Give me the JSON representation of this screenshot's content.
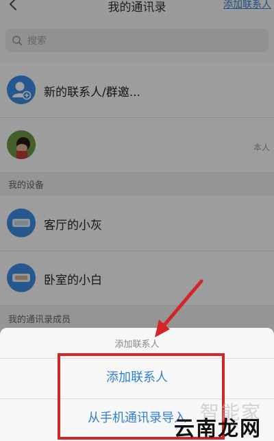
{
  "header": {
    "title": "我的通讯录",
    "add_link": "添加联系人"
  },
  "search": {
    "placeholder": "搜索"
  },
  "rows": {
    "new_contacts": {
      "label": "新的联系人/群邀..."
    },
    "self": {
      "meta": "本人"
    }
  },
  "sections": {
    "devices": "我的设备",
    "members": "我的通讯录成员"
  },
  "devices": [
    {
      "label": "客厅的小灰"
    },
    {
      "label": "卧室的小白"
    }
  ],
  "sheet": {
    "title": "添加联系人",
    "options": [
      "添加联系人",
      "从手机通讯录导入"
    ]
  },
  "watermarks": {
    "top": "智能家",
    "bottom": "云南龙网"
  },
  "colors": {
    "accent": "#2f7fd6",
    "annotation": "#d2252a"
  },
  "icons": {
    "back": "chevron-left-icon",
    "search": "search-icon",
    "new_contact": "add-user-icon",
    "device": "device-icon"
  }
}
